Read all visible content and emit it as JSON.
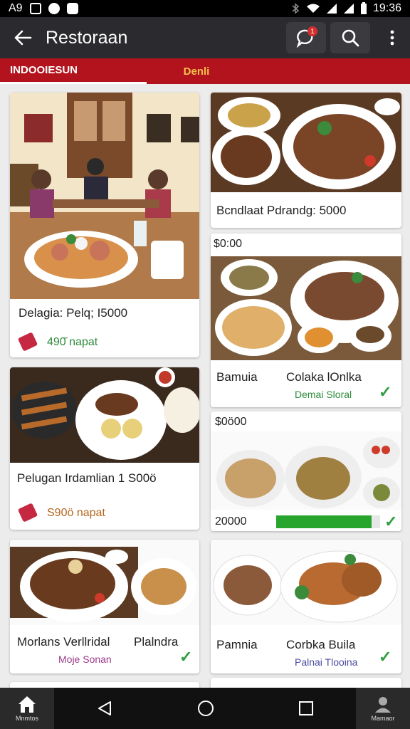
{
  "status_bar": {
    "left_text": "A9",
    "time": "19:36"
  },
  "app_bar": {
    "title": "Restoraan",
    "notification_count": "1"
  },
  "tabs": [
    {
      "label": "INDOOIESUN"
    },
    {
      "label": "Denli"
    }
  ],
  "cards": [
    {
      "title": "Delagia: Pelq; I5000",
      "sub": "490̆ napat",
      "sub_color": "#2e8b3a"
    },
    {
      "title": "Bcndlaat  Pdrandg: 5000",
      "sub": ""
    },
    {
      "price_top": "$0:00",
      "left": "Bamuia",
      "right": "Colaka lOnlka",
      "sub": "Demai Sloral",
      "sub_color": "#2e8b3a",
      "check": "✓"
    },
    {
      "title": "Pelugan Irdamlian 1 S00ö",
      "sub": "S90ö  napat",
      "sub_color": "#b5651d"
    },
    {
      "price_top": "$0ö00",
      "price_bottom": "20000",
      "progress": 0.92,
      "check": "✓"
    },
    {
      "left": "Morlans Verllridal",
      "right": "Plalndra",
      "sub": "Moje Sonan",
      "sub_color": "#9b3a8a",
      "check": "✓"
    },
    {
      "left": "Pamnia",
      "right": "Corbka Buila",
      "sub": "Palnai Tlooina",
      "sub_color": "#4a4aa0",
      "check": "✓"
    }
  ],
  "bottom_nav": {
    "home_label": "Mnmtos",
    "profile_label": "Mamaor"
  },
  "colors": {
    "brand_red": "#b3131d",
    "appbar": "#2b2b2f",
    "accent_yellow": "#f3c14b",
    "success_green": "#27a52c"
  }
}
